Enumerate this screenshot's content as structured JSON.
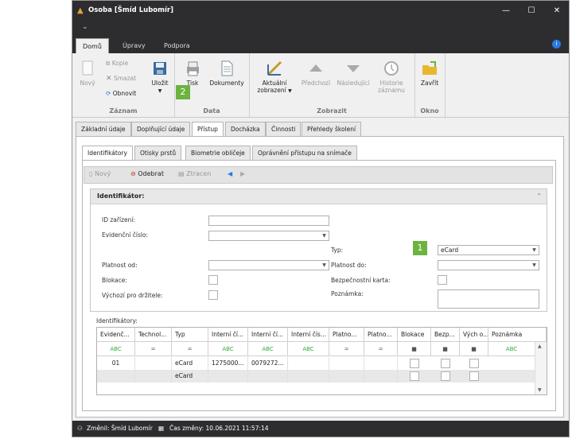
{
  "window": {
    "title": "Osoba [Šmíd Lubomír]"
  },
  "ribbon_tabs": [
    "Domů",
    "Úpravy",
    "Podpora"
  ],
  "ribbon": {
    "zaznam": {
      "label": "Záznam",
      "novy": "Nový",
      "kopie": "Kopie",
      "smazat": "Smazat",
      "obnovit": "Obnovit",
      "ulozit": "Uložit"
    },
    "data": {
      "label": "Data",
      "tisk": "Tisk",
      "dokumenty": "Dokumenty"
    },
    "zobrazit": {
      "label": "Zobrazit",
      "aktualni": "Aktuální",
      "zobrazeni": "zobrazení",
      "predchozi": "Předchozí",
      "nasledujici": "Následující",
      "historie": "Historie",
      "zaznamu": "záznamu"
    },
    "okno": {
      "label": "Okno",
      "zavrit": "Zavřít"
    }
  },
  "badges": {
    "one": "1",
    "two": "2"
  },
  "tabs": [
    "Základní údaje",
    "Doplňující údaje",
    "Přístup",
    "Docházka",
    "Činnosti",
    "Přehledy školení"
  ],
  "subtabs": [
    "Identifikátory",
    "Otisky prstů",
    "Biometrie obličeje",
    "Oprávnění přístupu na snímače"
  ],
  "toolbar": {
    "novy": "Nový",
    "odebrat": "Odebrat",
    "ztracen": "Ztracen"
  },
  "form": {
    "header": "Identifikátor:",
    "id_zarizeni": "ID zařízení:",
    "evidencni_cislo": "Evidenční číslo:",
    "typ": "Typ:",
    "typ_value": "eCard",
    "platnost_od": "Platnost od:",
    "platnost_do": "Platnost do:",
    "blokace": "Blokace:",
    "bezpecnostni_karta": "Bezpečnostní karta:",
    "vychozi": "Výchozí pro držitele:",
    "poznamka": "Poznámka:"
  },
  "grid": {
    "label": "Identifikátory:",
    "columns": [
      "Evidenč...",
      "Technol...",
      "Typ",
      "Interní čí...",
      "Interní čí...",
      "Interní čís...",
      "Platno...",
      "Platno...",
      "Blokace",
      "Bezp...",
      "Vých o...",
      "Poznámka"
    ],
    "filters": [
      "ABC",
      "=",
      "=",
      "ABC",
      "ABC",
      "ABC",
      "=",
      "=",
      "■",
      "■",
      "■",
      "ABC"
    ],
    "rows": [
      [
        "01",
        "",
        "eCard",
        "1275000...",
        "0079272...",
        "",
        "",
        ""
      ],
      [
        "",
        "",
        "eCard",
        "",
        "",
        "",
        "",
        ""
      ]
    ]
  },
  "status": {
    "zmenil": "Změnil: Šmíd Lubomír",
    "cas": "Čas změny: 10.06.2021 11:57:14"
  }
}
